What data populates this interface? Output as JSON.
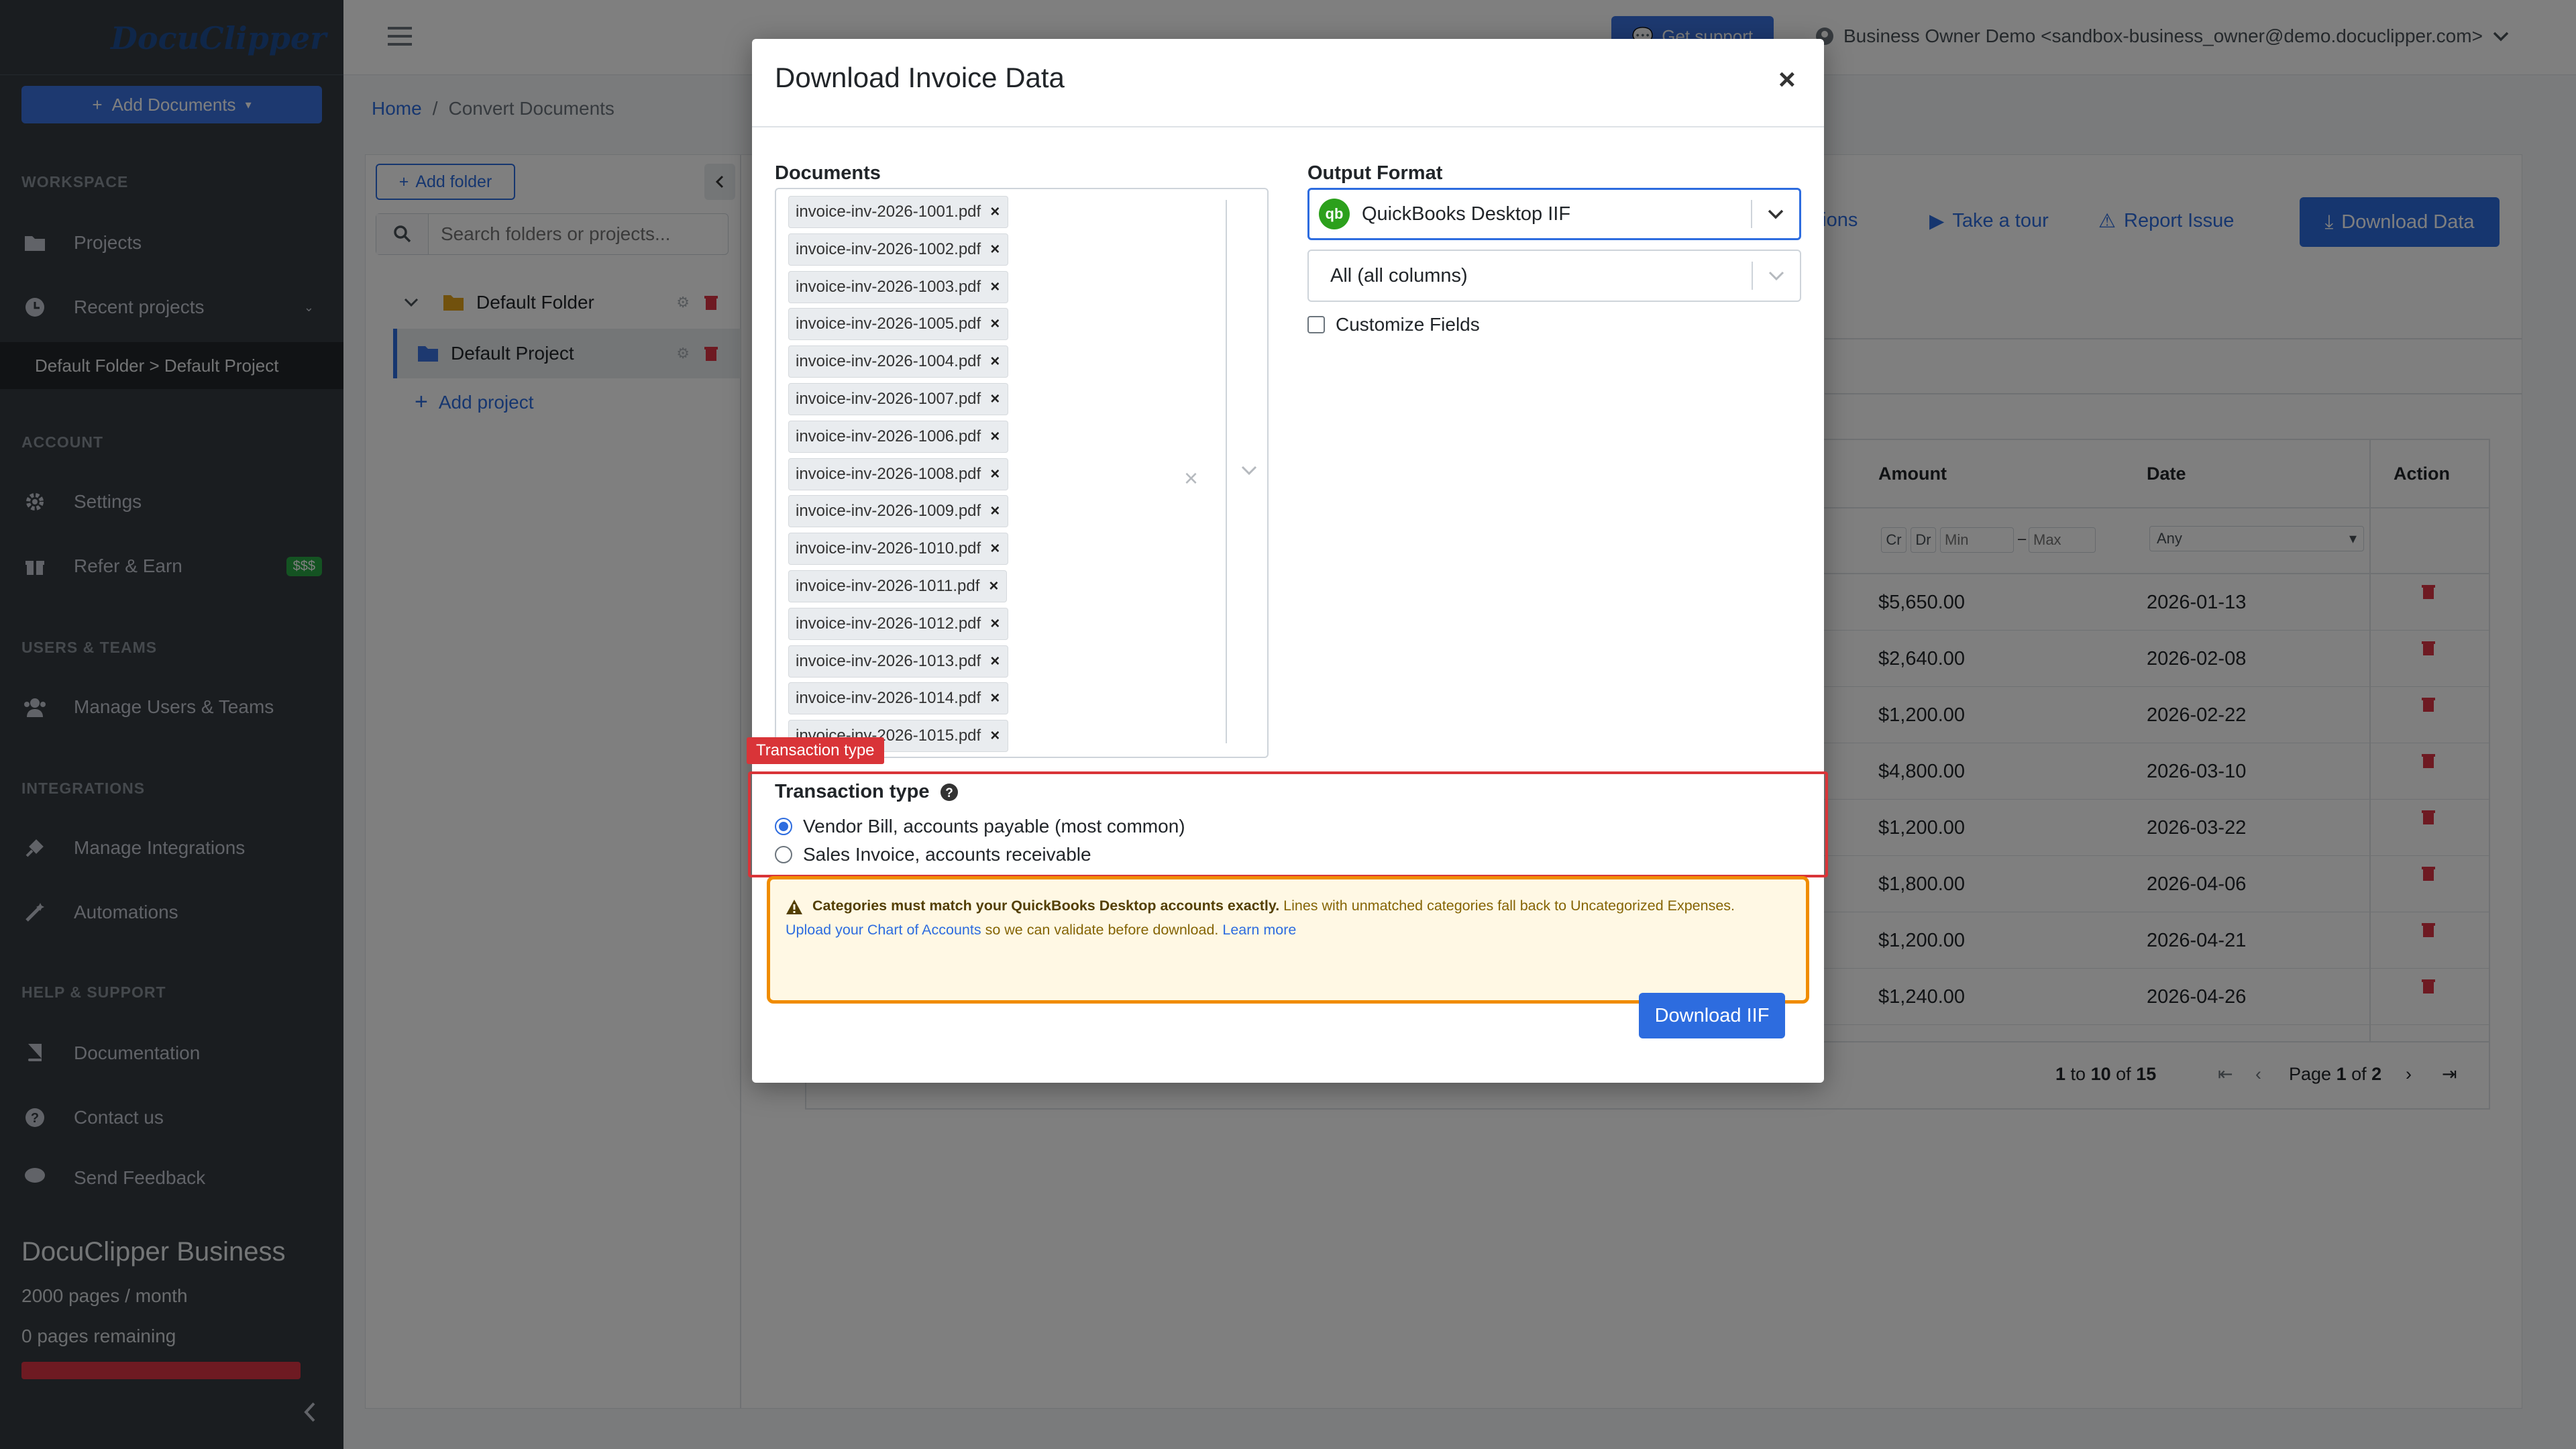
{
  "brand": {
    "logo_text": "DocuClipper"
  },
  "sidebar": {
    "add_documents": "Add Documents",
    "sections": {
      "workspace": "WORKSPACE",
      "account": "ACCOUNT",
      "users_teams": "USERS & TEAMS",
      "integrations": "INTEGRATIONS",
      "help": "HELP & SUPPORT"
    },
    "items": {
      "projects": "Projects",
      "recent_projects": "Recent projects",
      "recent_sub": "Default Folder > Default Project",
      "settings": "Settings",
      "refer": "Refer & Earn",
      "refer_badge": "$$$",
      "manage_users": "Manage Users & Teams",
      "manage_integrations": "Manage Integrations",
      "automations": "Automations",
      "documentation": "Documentation",
      "contact": "Contact us",
      "feedback": "Send Feedback"
    },
    "plan": {
      "name": "DocuClipper Business",
      "pages_month": "2000 pages / month",
      "pages_remaining": "0 pages remaining"
    }
  },
  "header": {
    "get_support": "Get support",
    "user": "Business Owner Demo <sandbox-business_owner@demo.docuclipper.com>"
  },
  "breadcrumb": {
    "home": "Home",
    "sep": "/",
    "current": "Convert Documents"
  },
  "folders": {
    "add_folder": "Add folder",
    "search_placeholder": "Search folders or projects...",
    "folder": "Default Folder",
    "project": "Default Project",
    "add_project": "Add project"
  },
  "toolbar": {
    "integrations_partial": "ations",
    "take_tour": "Take a tour",
    "report_issue": "Report Issue",
    "download_data": "Download Data"
  },
  "table": {
    "headers": {
      "amount": "Amount",
      "date": "Date",
      "action": "Action"
    },
    "filters": {
      "cr": "Cr",
      "dr": "Dr",
      "min": "Min",
      "dash": "–",
      "max": "Max",
      "date_any": "Any"
    },
    "rows": [
      {
        "amount": "$5,650.00",
        "date": "2026-01-13"
      },
      {
        "amount": "$2,640.00",
        "date": "2026-02-08"
      },
      {
        "amount": "$1,200.00",
        "date": "2026-02-22"
      },
      {
        "amount": "$4,800.00",
        "date": "2026-03-10"
      },
      {
        "amount": "$1,200.00",
        "date": "2026-03-22"
      },
      {
        "amount": "$1,800.00",
        "date": "2026-04-06"
      },
      {
        "amount": "$1,200.00",
        "date": "2026-04-21"
      },
      {
        "amount": "$1,240.00",
        "date": "2026-04-26"
      }
    ],
    "pager": {
      "range_from": "1",
      "to": "to",
      "range_to": "10",
      "of": "of",
      "total": "15",
      "page_label": "Page",
      "page": "1",
      "page_of": "of",
      "pages": "2"
    }
  },
  "modal": {
    "title": "Download Invoice Data",
    "close": "×",
    "documents_label": "Documents",
    "documents": [
      "invoice-inv-2026-1001.pdf",
      "invoice-inv-2026-1002.pdf",
      "invoice-inv-2026-1003.pdf",
      "invoice-inv-2026-1005.pdf",
      "invoice-inv-2026-1004.pdf",
      "invoice-inv-2026-1007.pdf",
      "invoice-inv-2026-1006.pdf",
      "invoice-inv-2026-1008.pdf",
      "invoice-inv-2026-1009.pdf",
      "invoice-inv-2026-1010.pdf",
      "invoice-inv-2026-1011.pdf",
      "invoice-inv-2026-1012.pdf",
      "invoice-inv-2026-1013.pdf",
      "invoice-inv-2026-1014.pdf",
      "invoice-inv-2026-1015.pdf"
    ],
    "output_format_label": "Output Format",
    "output_format_value": "QuickBooks Desktop IIF",
    "qb_logo": "qb",
    "columns_value": "All (all columns)",
    "customize_fields": "Customize Fields",
    "transaction_tag": "Transaction type",
    "transaction_label": "Transaction type",
    "options": [
      {
        "label": "Vendor Bill, accounts payable (most common)",
        "selected": true
      },
      {
        "label": "Sales Invoice, accounts receivable",
        "selected": false
      }
    ],
    "warning": {
      "bold": "Categories must match your QuickBooks Desktop accounts exactly.",
      "text1": " Lines with unmatched categories fall back to Uncategorized Expenses. ",
      "link": "Upload your Chart of Accounts",
      "text2": " so we can validate before download. ",
      "learn_more": "Learn more"
    },
    "download_button": "Download IIF"
  },
  "colors": {
    "primary": "#2d6cdf",
    "sidebar_bg": "#343a40",
    "danger": "#d93438",
    "warning_border": "#f08c00",
    "warning_bg": "#fff8e4",
    "quickbooks_green": "#2ca01c"
  },
  "icons": [
    "hamburger-icon",
    "folder-icon",
    "clock-icon",
    "gear-icon",
    "gift-icon",
    "users-icon",
    "plug-icon",
    "magic-wand-icon",
    "book-icon",
    "question-icon",
    "comment-icon",
    "user-circle-icon",
    "chevron-down-icon",
    "search-icon",
    "trash-icon",
    "plus-icon",
    "play-icon",
    "warning-icon",
    "download-icon",
    "chevron-left-icon"
  ]
}
